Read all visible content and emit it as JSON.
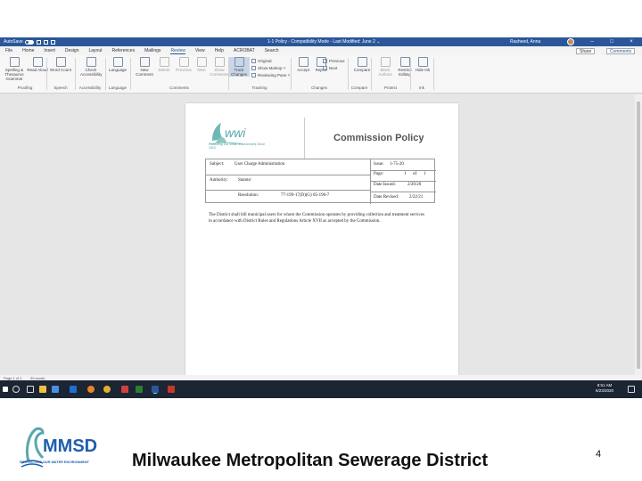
{
  "window": {
    "autosave_label": "AutoSave",
    "document_title": "1-1 Policy - Compatibility Mode - Last Modified: June 2 ⌄",
    "user_name": "Rasheed, Anna"
  },
  "ribbon_tabs": [
    "File",
    "Home",
    "Insert",
    "Design",
    "Layout",
    "References",
    "Mailings",
    "Review",
    "View",
    "Help",
    "ACROBAT",
    "Search"
  ],
  "active_tab": "Review",
  "header_buttons": {
    "share": "Share",
    "comments": "Comments"
  },
  "ribbon": {
    "buttons": [
      {
        "label": "Spelling & Thesaurus Grammar",
        "state": "normal"
      },
      {
        "label": "Read Aloud",
        "state": "normal"
      },
      {
        "label": "Word Count",
        "state": "normal"
      },
      {
        "label": "Check Accessibility",
        "state": "normal"
      },
      {
        "label": "Language",
        "state": "normal"
      },
      {
        "label": "New Comment",
        "state": "normal"
      },
      {
        "label": "Delete",
        "state": "dim"
      },
      {
        "label": "Previous",
        "state": "dim"
      },
      {
        "label": "Next",
        "state": "dim"
      },
      {
        "label": "Show Comments",
        "state": "dim"
      },
      {
        "label": "Track Changes",
        "state": "selected"
      },
      {
        "label": "Accept",
        "state": "normal"
      },
      {
        "label": "Reject",
        "state": "normal"
      },
      {
        "label": "Compare",
        "state": "normal"
      },
      {
        "label": "Block Authors",
        "state": "dim"
      },
      {
        "label": "Restrict Editing",
        "state": "normal"
      },
      {
        "label": "Hide Ink",
        "state": "normal"
      }
    ],
    "tracking_rows": [
      "Original",
      "Show Markup ˅",
      "Reviewing Pane ˅"
    ],
    "changes_rows": [
      "Previous",
      "Next"
    ],
    "groups": [
      "Proofing",
      "Speech",
      "Accessibility",
      "Language",
      "Comments",
      "Tracking",
      "Changes",
      "Compare",
      "Protect",
      "Ink"
    ]
  },
  "document": {
    "logo_caption": "Protecting Our Water Environment Since 1913",
    "policy_title": "Commission Policy",
    "subject_label": "Subject:",
    "subject_value": "User Charge Administration",
    "issue_label": "Issue:",
    "issue_value": "1-75-20",
    "page_label": "Page:",
    "page_value": "1",
    "page_of": "of",
    "page_total": "1",
    "authority_label": "Authority:",
    "statute_label": "Statute:",
    "resolution_label": "Resolution:",
    "resolution_value": "77-199-17(D)(G) 05-196-7",
    "date_issued_label": "Date Issued:",
    "date_issued_value": "2/20/20",
    "date_revised_label": "Date Revised:",
    "date_revised_value": "2/22/21",
    "body_text": "The District shall bill municipal users for whom the Commission operates by providing collection and treatment services in accordance with District Rules and Regulations Article XVII as accepted by the Commission."
  },
  "statusbar": {
    "page_info": "Page 1 of 1",
    "words": "99 words"
  },
  "taskbar": {
    "time": "8:51 AM",
    "date": "6/23/2020"
  },
  "footer": {
    "logo_text": "MMSD",
    "logo_tagline": "PROTECTING OUR WATER ENVIRONMENT",
    "organization": "Milwaukee Metropolitan Sewerage District",
    "slide_number": "4"
  },
  "colors": {
    "word_blue": "#2b579a",
    "mmsd_blue": "#1f5fae",
    "logo_teal": "#4f9b9e"
  }
}
